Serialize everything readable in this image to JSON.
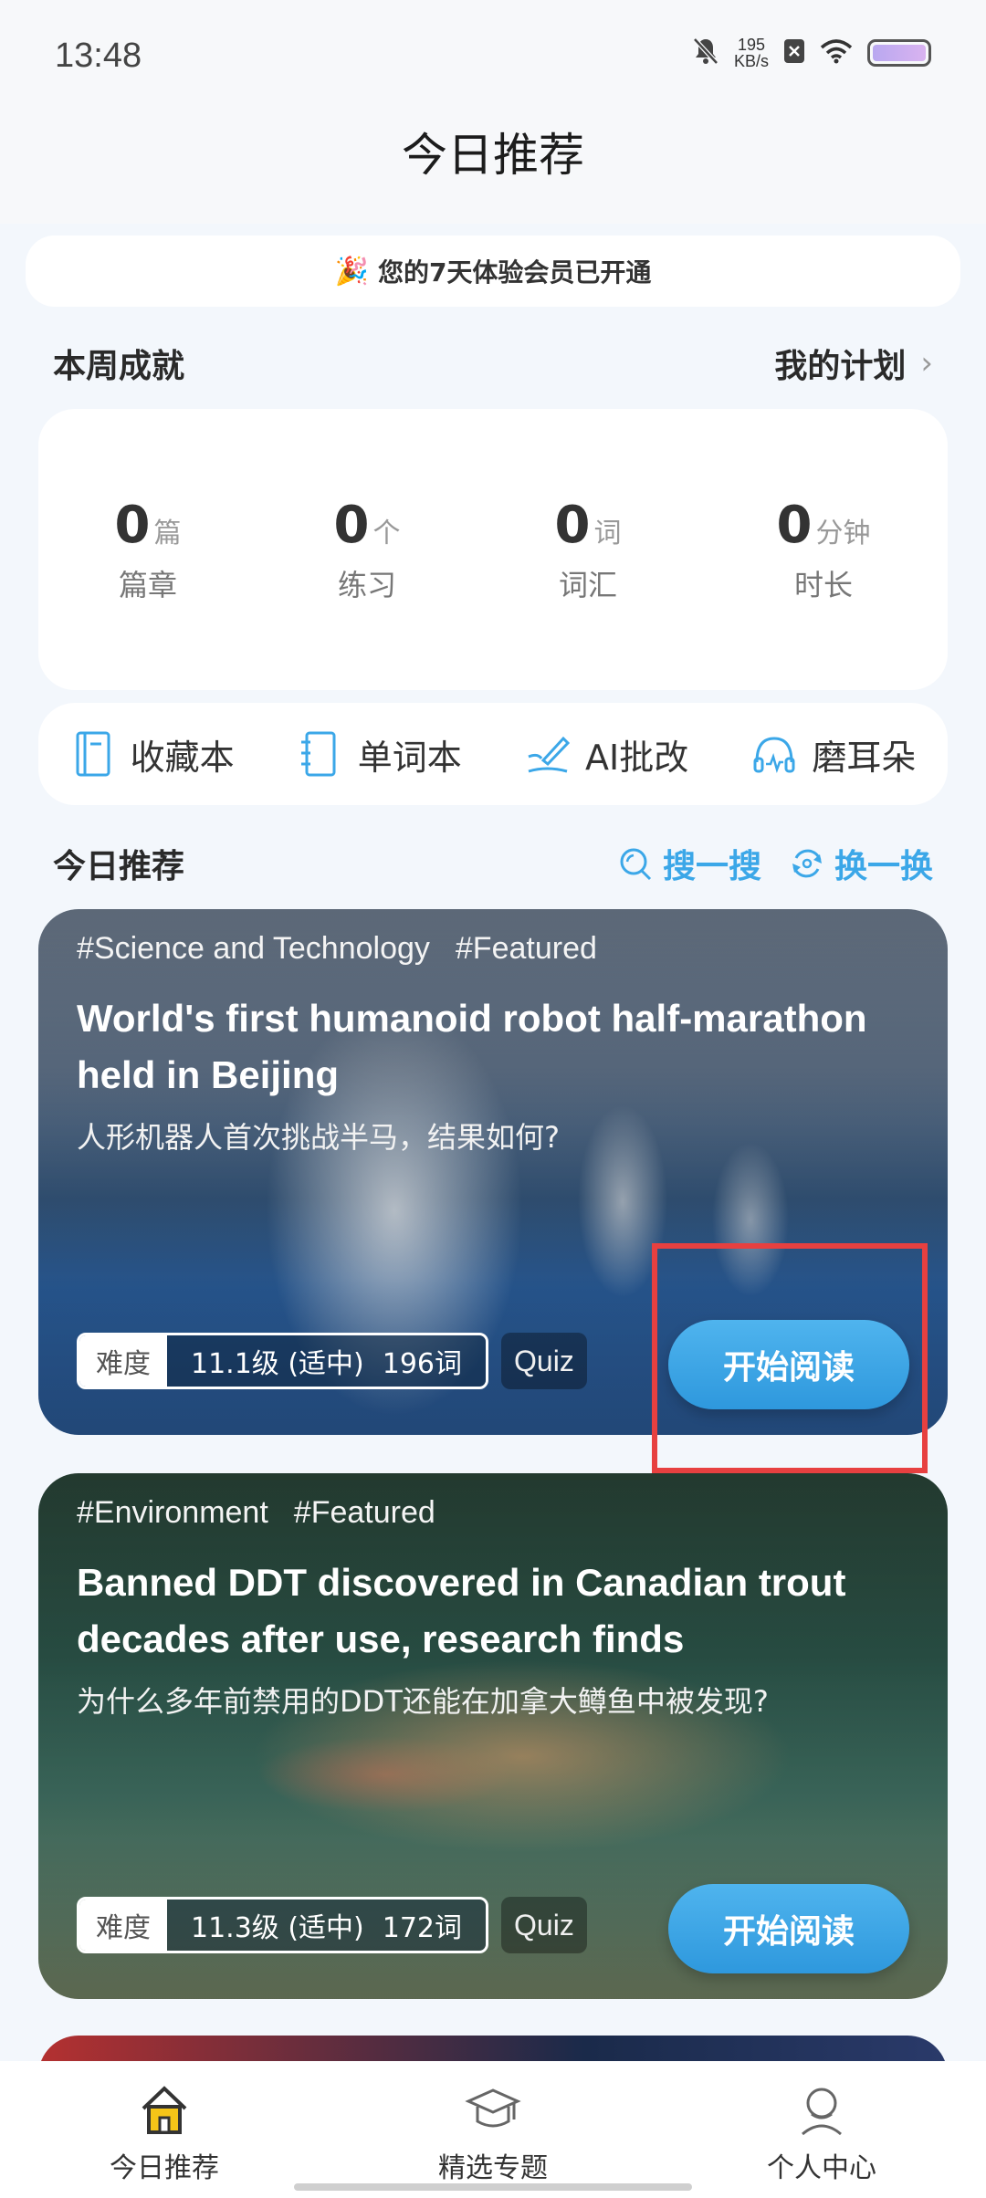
{
  "status_bar": {
    "time": "13:48",
    "net_speed_value": "195",
    "net_speed_unit": "KB/s"
  },
  "header": {
    "title": "今日推荐"
  },
  "notice": {
    "emoji": "🎉",
    "text": "您的7天体验会员已开通"
  },
  "weekly": {
    "title": "本周成就",
    "plan_link": "我的计划",
    "stats": [
      {
        "value": "0",
        "unit": "篇",
        "label": "篇章"
      },
      {
        "value": "0",
        "unit": "个",
        "label": "练习"
      },
      {
        "value": "0",
        "unit": "词",
        "label": "词汇"
      },
      {
        "value": "0",
        "unit": "分钟",
        "label": "时长"
      }
    ]
  },
  "tools": [
    {
      "label": "收藏本",
      "icon": "notebook-icon"
    },
    {
      "label": "单词本",
      "icon": "wordbook-icon"
    },
    {
      "label": "AI批改",
      "icon": "pen-icon"
    },
    {
      "label": "磨耳朵",
      "icon": "headphones-icon"
    }
  ],
  "recommend": {
    "title": "今日推荐",
    "search_label": "搜一搜",
    "refresh_label": "换一换"
  },
  "articles": [
    {
      "tag1": "#Science and Technology",
      "tag2": "#Featured",
      "title": "World's first humanoid robot half-marathon held in Beijing",
      "subtitle": "人形机器人首次挑战半马，结果如何?",
      "difficulty_label": "难度",
      "level": "11.1级 (适中)",
      "words": "196词",
      "quiz": "Quiz",
      "button": "开始阅读"
    },
    {
      "tag1": "#Environment",
      "tag2": "#Featured",
      "title": "Banned DDT discovered in Canadian trout decades after use, research finds",
      "subtitle": "为什么多年前禁用的DDT还能在加拿大鳟鱼中被发现?",
      "difficulty_label": "难度",
      "level": "11.3级 (适中)",
      "words": "172词",
      "quiz": "Quiz",
      "button": "开始阅读"
    }
  ],
  "tabbar": [
    {
      "label": "今日推荐",
      "icon": "home-icon",
      "active": true
    },
    {
      "label": "精选专题",
      "icon": "graduation-cap-icon",
      "active": false
    },
    {
      "label": "个人中心",
      "icon": "user-icon",
      "active": false
    }
  ],
  "colors": {
    "accent": "#3ba7e8",
    "highlight": "#e74040",
    "home_icon": "#f5c518"
  }
}
